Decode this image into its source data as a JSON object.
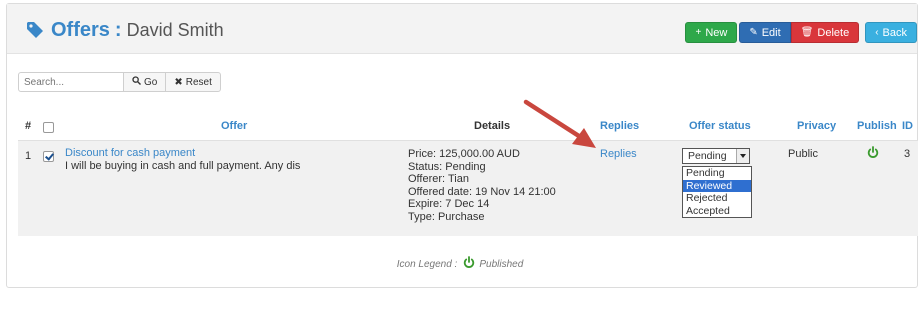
{
  "header": {
    "title": "Offers",
    "separator": ":",
    "subtitle": "David Smith",
    "buttons": {
      "new": "New",
      "edit": "Edit",
      "delete": "Delete",
      "back": "Back"
    }
  },
  "search": {
    "placeholder": "Search...",
    "go": "Go",
    "reset": "Reset"
  },
  "table": {
    "columns": {
      "num": "#",
      "offer": "Offer",
      "details": "Details",
      "replies": "Replies",
      "status": "Offer status",
      "privacy": "Privacy",
      "publish": "Publish",
      "id": "ID"
    },
    "rows": [
      {
        "num": "1",
        "offer_title": "Discount for cash payment",
        "offer_desc": "I will be buying in cash and full payment. Any dis",
        "details": {
          "price": "Price: 125,000.00 AUD",
          "status": "Status: Pending",
          "offerer": "Offerer: Tian",
          "offered_date": "Offered date: 19 Nov 14 21:00",
          "expire": "Expire: 7 Dec 14",
          "type": "Type: Purchase"
        },
        "replies": "Replies",
        "status_selected": "Pending",
        "status_options": [
          "Pending",
          "Reviewed",
          "Rejected",
          "Accepted"
        ],
        "status_highlighted": "Reviewed",
        "privacy": "Public",
        "id": "3"
      }
    ]
  },
  "legend": {
    "label": "Icon Legend :",
    "published": "Published"
  },
  "colors": {
    "accent": "#3a87c8",
    "new": "#2ea84a",
    "edit": "#2f6db3",
    "delete": "#d9363b",
    "back": "#3ab0e0",
    "published": "#3a9a2e",
    "annotation_arrow": "#c9473e"
  },
  "icons": {
    "title": "tag-icon",
    "new": "plus-icon",
    "edit": "edit-icon",
    "delete": "trash-icon",
    "back": "chevron-left-icon",
    "go": "search-icon",
    "reset": "x-icon",
    "publish": "power-icon"
  }
}
